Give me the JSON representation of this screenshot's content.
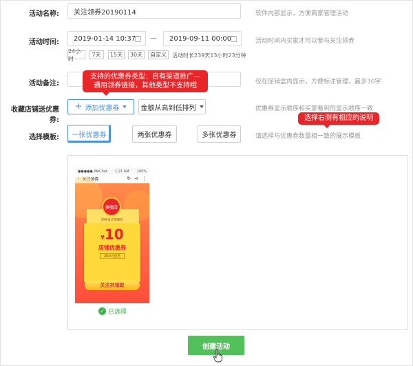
{
  "form": {
    "name_label": "活动名称:",
    "name_value": "关注领券20190114",
    "name_hint": "软件内部显示，方便商家管理活动",
    "time_label": "活动时间:",
    "start_time": "2019-01-14 10:37",
    "time_separator": "—",
    "end_time": "2019-09-11 00:00",
    "time_hint": "活动时间内买家才可以参与关注领券",
    "quick_durations": [
      "24小时",
      "7天",
      "15天",
      "30天",
      "自定义"
    ],
    "duration_text": "活动时长239天13小时23分钟",
    "remark_label": "活动备注:",
    "remark_value": "",
    "remark_hint": "仅在促销盒内显示，方便标注管理，最多30字",
    "coupon_label": "收藏店铺送优惠券:",
    "add_coupon_label": "添加优惠券",
    "sort_label": "金额从高到低排列",
    "coupon_hint": "优惠券显示顺序和买家看到的显示顺序一致",
    "template_label": "选择模板:",
    "templates": [
      "一张优惠券",
      "两张优惠券",
      "多张优惠券"
    ],
    "template_hint": "请选择与优惠券数量相一致的展示模板",
    "selected_text": "已选择",
    "create_label": "创建活动"
  },
  "tooltips": {
    "coupon_tip_line1": "支持的优惠券类型：自有渠道推广—",
    "coupon_tip_line2": "通用领券链接，其他类型不支持哦",
    "template_tip": "选择右侧有相应的说明"
  },
  "preview": {
    "status_left": "●●●●● WeChat",
    "status_time": "1:21 AM",
    "status_right": "100%",
    "nav_title": "关注领券",
    "nav_icons": [
      "refresh-icon",
      "share-icon",
      "more-icon"
    ],
    "shop_badge": "旗舰店",
    "shop_name": "图先设计旗舰店",
    "currency": "¥",
    "amount": "10",
    "coupon_title": "店铺优惠券",
    "condition": "满50元使用",
    "follow_btn": "关注并领取"
  },
  "colors": {
    "accent_blue": "#4a90e2",
    "tooltip_red": "#e8262a",
    "create_green": "#52c05b",
    "selected_green": "#3cb34a"
  }
}
